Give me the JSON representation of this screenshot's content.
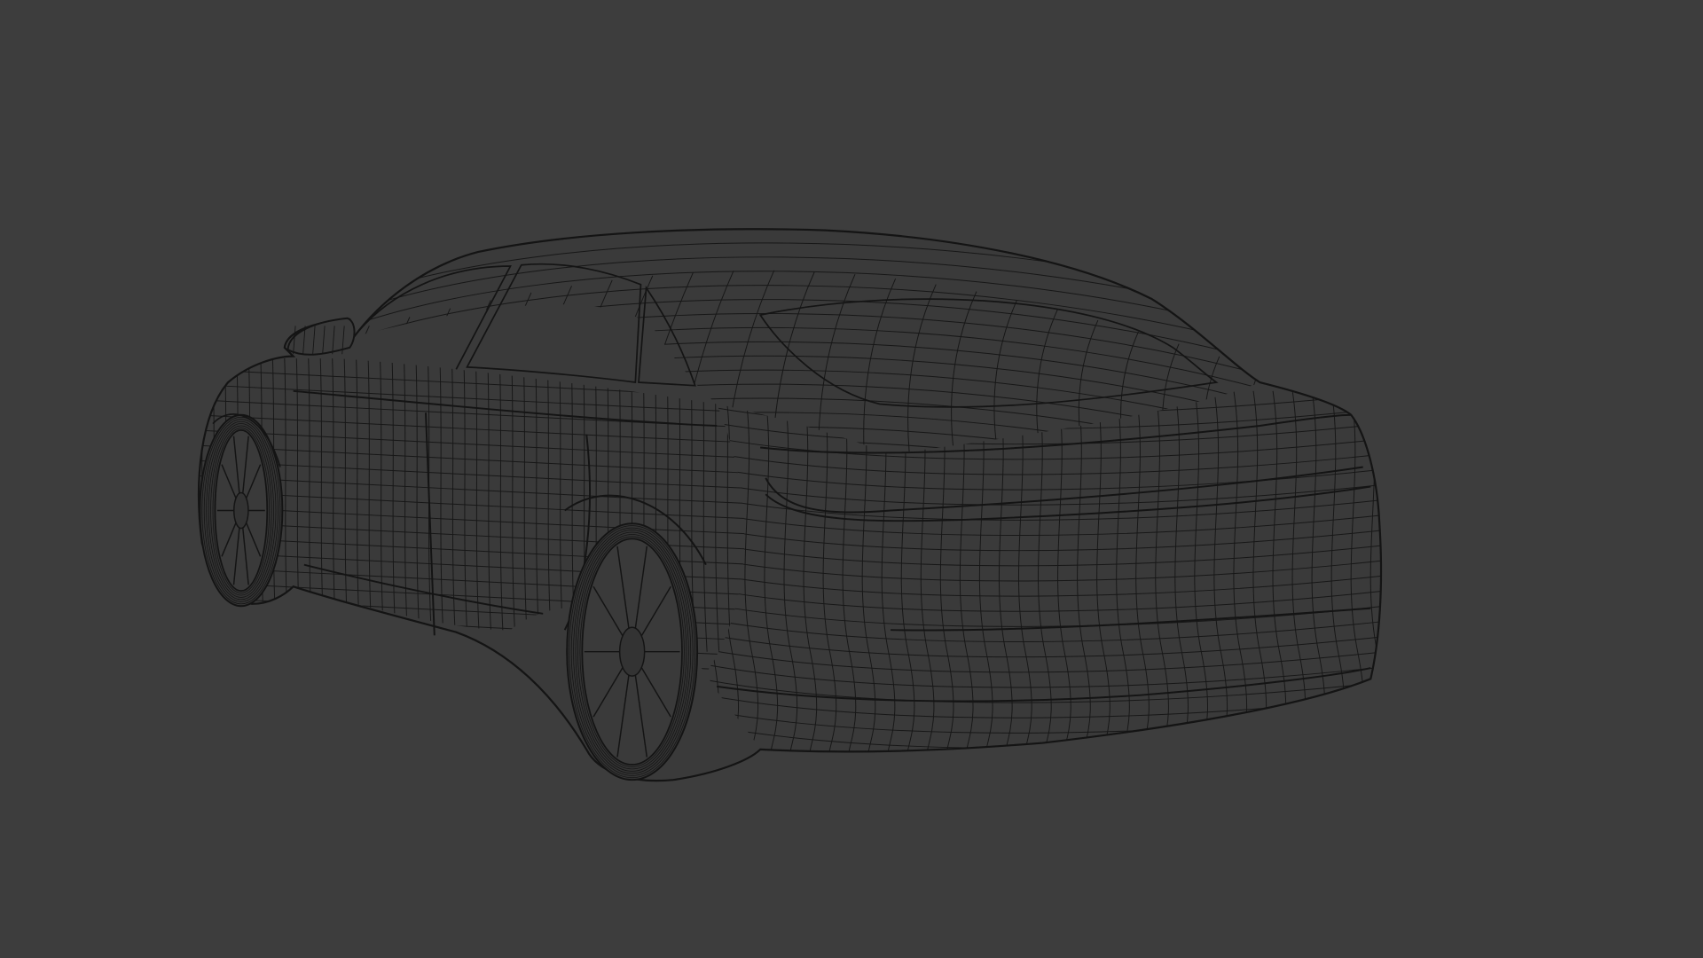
{
  "viewport": {
    "background_color": "#3d3d3d",
    "wire_color": "#141414",
    "body_fill": "#3a3a3a",
    "tire_fill": "#333333"
  },
  "subject": {
    "icon": "car-wireframe-icon"
  }
}
